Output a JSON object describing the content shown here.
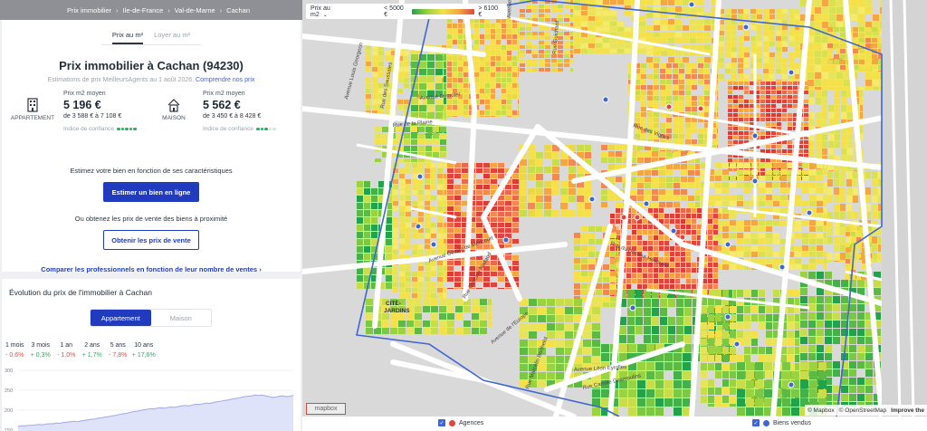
{
  "breadcrumb": [
    "Prix immobilier",
    "Ile-de-France",
    "Val-de-Marne",
    "Cachan"
  ],
  "tabs": {
    "active": "Prix au m²",
    "other": "Loyer au m²"
  },
  "title": "Prix immobilier à Cachan (94230)",
  "subtitle": "Estimations de prix MeilleursAgents au 1 août 2026.",
  "subtitle_link": "Comprendre nos prix",
  "appartement": {
    "type": "APPARTEMENT",
    "label": "Prix m2 moyen",
    "value": "5 196 €",
    "range": "de 3 588 € à 7 108 €",
    "confidence_label": "Indice de confiance",
    "confidence": 5
  },
  "maison": {
    "type": "MAISON",
    "label": "Prix m2 moyen",
    "value": "5 562 €",
    "range": "de 3 450 € à 8 428 €",
    "confidence_label": "Indice de confiance",
    "confidence": 3
  },
  "estimate_text": "Estimez votre bien en fonction de ses caractéristiques",
  "estimate_button": "Estimer un bien en ligne",
  "sales_text": "Ou obtenez les prix de vente des biens à proximité",
  "sales_button": "Obtenir les prix de vente",
  "compare_link": "Comparer les professionnels en fonction de leur nombre de ventes",
  "compare_arrow": "›",
  "evolution": {
    "title": "Évolution du prix de l'immobilier à Cachan",
    "toggle": [
      "Appartement",
      "Maison"
    ],
    "periods": [
      {
        "label": "1 mois",
        "change": "- 0,6%",
        "dir": "neg"
      },
      {
        "label": "3 mois",
        "change": "+ 0,3%",
        "dir": "pos"
      },
      {
        "label": "1 an",
        "change": "- 1,0%",
        "dir": "neg"
      },
      {
        "label": "2 ans",
        "change": "+ 1,7%",
        "dir": "pos"
      },
      {
        "label": "5 ans",
        "change": "- 7,8%",
        "dir": "neg"
      },
      {
        "label": "10 ans",
        "change": "+ 17,6%",
        "dir": "pos"
      }
    ]
  },
  "chart_data": {
    "type": "area",
    "title": "",
    "yticks": [
      "300",
      "250",
      "200",
      "150"
    ],
    "ylim": [
      150,
      300
    ],
    "values": [
      160,
      161,
      161,
      162,
      162,
      163,
      164,
      163,
      165,
      166,
      166,
      168,
      167,
      169,
      170,
      171,
      172,
      171,
      173,
      174,
      176,
      177,
      178,
      180,
      181,
      183,
      184,
      186,
      187,
      189,
      191,
      192,
      194,
      196,
      197,
      199,
      201,
      202,
      204,
      203,
      205,
      206,
      205,
      207,
      208,
      207,
      209,
      211,
      212,
      211,
      213,
      215,
      214,
      216,
      218,
      217,
      219,
      221,
      222,
      224,
      225,
      227,
      229,
      230,
      232,
      234,
      235,
      236,
      238,
      237,
      238,
      236,
      234,
      232,
      233,
      235,
      236,
      234,
      235,
      237
    ],
    "color": "#9fa9ea"
  },
  "map": {
    "legend_select": "Prix au m2",
    "legend_low": "< 5000 €",
    "legend_high": "> 6100 €",
    "attribution": [
      "© Mapbox",
      "© OpenStreetMap"
    ],
    "improve": "Improve the",
    "logo": "mapbox",
    "label_jardins": [
      "CITÉ-",
      "JARDINS"
    ],
    "streets": [
      "Avenue Louis Georgeon",
      "Rue des Saussaies",
      "Rue de la Plaine",
      "Avenue Dumotel",
      "Rue des Vignes",
      "Avenue Carnot",
      "Rue Guichard",
      "Rue du Docteur Hénouille",
      "Avenue Cousin de Méricourt",
      "Rue Gustave Nadaud",
      "Avenue de l'Europe",
      "Rue Marcelin Berthelot",
      "Rue Camille Desmoulins",
      "Avenue Léon Eyrolles"
    ]
  },
  "bottom": {
    "agences": "Agences",
    "biens": "Biens vendus"
  },
  "colors": {
    "brand": "#203bbd",
    "agences": "#e0453d",
    "biens": "#3f66d1",
    "boundary": "#3f66d1"
  }
}
